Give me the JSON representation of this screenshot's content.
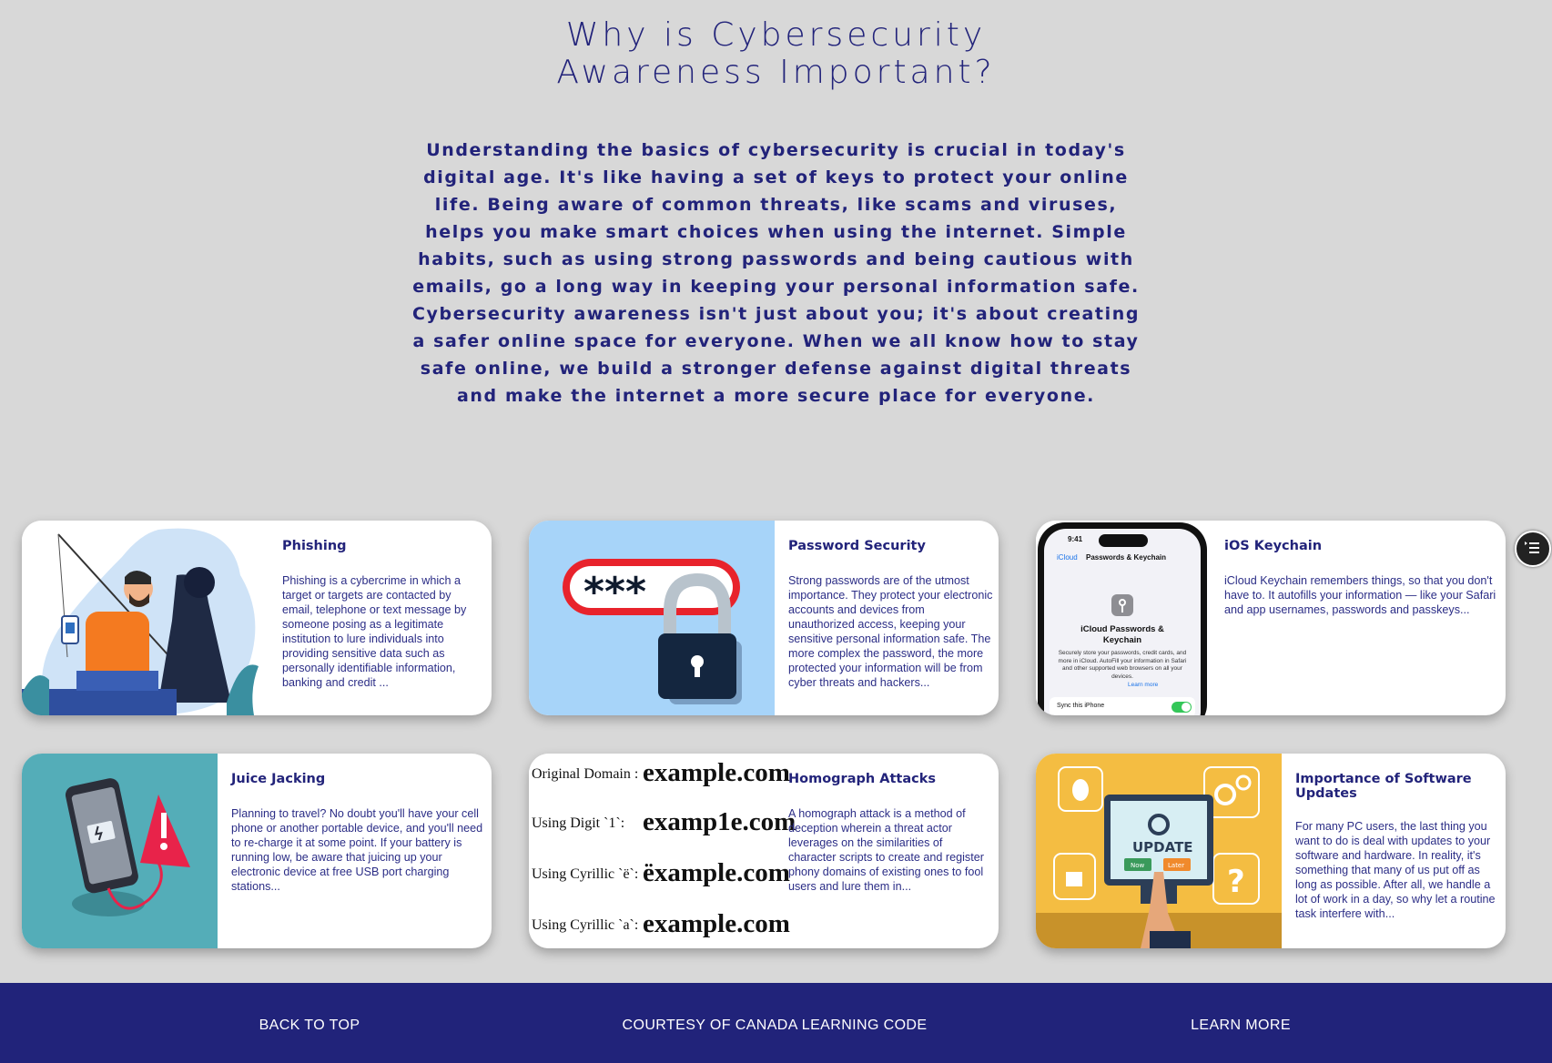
{
  "hero": {
    "title_line1": "Why is Cybersecurity",
    "title_line2": "Awareness Important?",
    "paragraph": "Understanding the basics of cybersecurity is crucial in today's digital age. It's like having a set of keys to protect your online life. Being aware of common threats, like scams and viruses, helps you make smart choices when using the internet. Simple habits, such as using strong passwords and being cautious with emails, go a long way in keeping your personal information safe. Cybersecurity awareness isn't just about you; it's about creating a safer online space for everyone. When we all know how to stay safe online, we build a stronger defense against digital threats and make the internet a more secure place for everyone."
  },
  "cards": [
    {
      "title": "Phishing",
      "text": "Phishing is a cybercrime in which a target or targets are contacted by email, telephone or text message by someone posing as a legitimate institution to lure individuals into providing sensitive data such as personally identifiable information, banking and credit ..."
    },
    {
      "title": "Password Security",
      "text": "Strong passwords are of the utmost importance. They protect your electronic accounts and devices from unauthorized access, keeping your sensitive personal information safe. The more complex the password, the more protected your information will be from cyber threats and hackers...",
      "image_text": "***"
    },
    {
      "title": "iOS Keychain",
      "text": "iCloud Keychain remembers things, so that you don't have to. It autofills your information — like your Safari and app usernames, passwords and passkeys...",
      "phone": {
        "time": "9:41",
        "back": "iCloud",
        "nav_title": "Passwords & Keychain",
        "heading": "iCloud Passwords & Keychain",
        "desc": "Securely store your passwords, credit cards, and more in iCloud. AutoFill your information in Safari and other supported web browsers on all your devices.",
        "learn_more": "Learn more",
        "toggle_label": "Sync this iPhone"
      }
    },
    {
      "title": "Juice Jacking",
      "text": "Planning to travel? No doubt you'll have your cell phone or another portable device, and you'll need to re-charge it at some point. If your battery is running low, be aware that juicing up your electronic device at free USB port charging stations..."
    },
    {
      "title": "Homograph Attacks",
      "text": "A homograph attack is a method of deception wherein a threat actor leverages on the similarities of character scripts to create and register phony domains of existing ones to fool users and lure them in...",
      "rows": [
        {
          "label": "Original Domain :",
          "domain": "example.com"
        },
        {
          "label": "Using Digit `1`:",
          "domain": "examp1e.com"
        },
        {
          "label": "Using Cyrillic `ë`:",
          "domain": "ëxample.com"
        },
        {
          "label": "Using Cyrillic `a`:",
          "domain": "example.com"
        }
      ]
    },
    {
      "title": "Importance of Software Updates",
      "text": "For many PC users, the last thing you want to do is deal with updates to your software and hardware. In reality, it's something that many of us put off as long as possible. After all, we handle a lot of work in a day, so why let a routine task interfere with...",
      "image_text": "UPDATE",
      "now": "Now",
      "later": "Later"
    }
  ],
  "footer": {
    "back_to_top": "BACK TO TOP",
    "courtesy": "COURTESY OF CANADA LEARNING CODE",
    "learn_more": "LEARN MORE"
  },
  "colors": {
    "navy": "#22237a",
    "background": "#d8d8d8",
    "footer": "#21237a"
  }
}
